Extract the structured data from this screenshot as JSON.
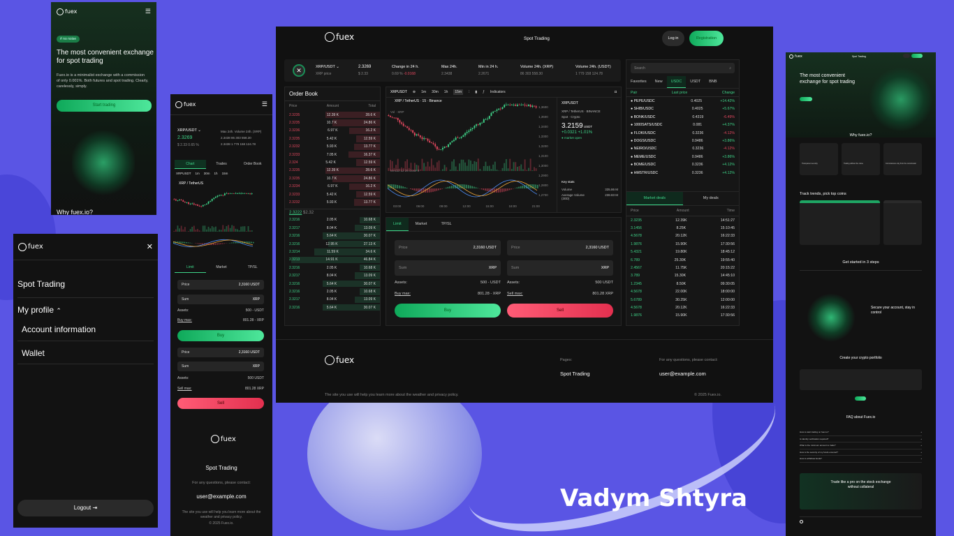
{
  "mobile_landing": {
    "logo": "fuex",
    "badge": "# no noise",
    "headline": "The most convenient exchange for spot trading",
    "description": "Fuex.io is a minimalist exchange with a commission of only 0.001%. Both futures and spot trading. Clearly, carelessly, simply.",
    "cta": "Start trading",
    "why": "Why fuex.io?"
  },
  "mobile_menu": {
    "logo": "fuex",
    "items": [
      "Spot Trading",
      "My profile"
    ],
    "sub_items": [
      "Account information",
      "Wallet"
    ],
    "logout": "Logout"
  },
  "mobile_trading": {
    "logo": "fuex",
    "pair": "XRP/USDT",
    "price": "2.3269",
    "price_sub": "$ 2.33 0.65 %",
    "stats_labels": [
      "Max 24h.",
      "Volume 24h. (XRP)"
    ],
    "stats_values": [
      "2.3438",
      "86 303 558.30"
    ],
    "stats_values2": [
      "2.3438",
      "1 779 158 124.78"
    ],
    "tabs": [
      "Chart",
      "Trades",
      "Order Book"
    ],
    "chart_symbol": "XRPUSDT",
    "timeframes": [
      "1m",
      "30m",
      "1h",
      "15m"
    ],
    "chart_title": "XRP / TetherUS",
    "order_tabs": [
      "Limit",
      "Market",
      "TP/SL"
    ],
    "price_label": "Price",
    "price_value": "2,3160 USDT",
    "sum_label": "Sum",
    "sum_unit": "XRP",
    "assets_label": "Assets:",
    "assets_value": "500 - USDT",
    "buy_max_label": "Buy max:",
    "buy_max_value": "801.28 - XRP",
    "buy": "Buy",
    "assets_value2": "500 USDT",
    "sell_max_label": "Sell max:",
    "sell_max_value": "801.28 XRP",
    "sell": "Sell",
    "footer_logo": "fuex",
    "footer_link": "Spot Trading",
    "footer_contact": "For any questions, please contact:",
    "footer_email": "user@example.com",
    "footer_note": "The site you use will help you learn more about the weather and privacy policy.",
    "footer_copy": "© 2025 Fuex.io."
  },
  "desktop": {
    "logo": "fuex",
    "nav_title": "Spot Trading",
    "login": "Log in",
    "register": "Registration",
    "ticker": {
      "pair": "XRP/USDT",
      "pair_sub": "XRP price",
      "price": "2.3269",
      "price_sub": "$ 2.33",
      "stats": [
        {
          "label": "Change in 24 h.",
          "value": "0.69 %",
          "value2": "-0.0168"
        },
        {
          "label": "Max 24h.",
          "value": "2.3438"
        },
        {
          "label": "Min in 24 h.",
          "value": "2.2671"
        },
        {
          "label": "Volume 24h. (XRP)",
          "value": "86 303 558.30"
        },
        {
          "label": "Volume 24h. (USDT)",
          "value": "1 779 158 124.78"
        }
      ]
    },
    "order_book": {
      "title": "Order Book",
      "headers": [
        "Price",
        "Amount",
        "Total"
      ],
      "asks": [
        [
          "2.3235",
          "12.39 K",
          "28.6 K"
        ],
        [
          "2.3235",
          "10.7 K",
          "24.86 K"
        ],
        [
          "2.3236",
          "6.97 K",
          "16.2 K"
        ],
        [
          "2.3235",
          "5.42 K",
          "12.59 K"
        ],
        [
          "2.3232",
          "5.93 K",
          "13.77 K"
        ],
        [
          "2.3233",
          "7.05 K",
          "16.37 K"
        ],
        [
          "2.324",
          "5.42 K",
          "12.59 K"
        ],
        [
          "2.3235",
          "12.39 K",
          "28.6 K"
        ],
        [
          "2.3235",
          "10.7 K",
          "24.86 K"
        ],
        [
          "2.3234",
          "6.97 K",
          "16.2 K"
        ],
        [
          "2.3233",
          "5.42 K",
          "12.59 K"
        ],
        [
          "2.3232",
          "5.93 K",
          "13.77 K"
        ]
      ],
      "mid": "2.3222",
      "mid_sub": "$2.32",
      "bids": [
        [
          "2.3216",
          "2.05 K",
          "10.68 K"
        ],
        [
          "2.3217",
          "8.04 K",
          "13.09 K"
        ],
        [
          "2.3216",
          "5.64 K",
          "30.07 K"
        ],
        [
          "2.3216",
          "12.95 K",
          "27.13 K"
        ],
        [
          "2.3214",
          "11.59 K",
          "34.6 K"
        ],
        [
          "2.3213",
          "14.91 K",
          "46.84 K"
        ],
        [
          "2.3216",
          "2.05 K",
          "10.68 K"
        ],
        [
          "2.3217",
          "8.04 K",
          "13.09 K"
        ],
        [
          "2.3216",
          "5.64 K",
          "30.07 K"
        ],
        [
          "2.3216",
          "2.05 K",
          "10.68 K"
        ],
        [
          "2.3217",
          "8.04 K",
          "13.09 K"
        ],
        [
          "2.3216",
          "5.64 K",
          "30.07 K"
        ]
      ]
    },
    "chart": {
      "symbol": "XRPUSDT",
      "timeframes": [
        "1m",
        "30m",
        "1h",
        "15m"
      ],
      "indicators": "Indicators",
      "title": "XRP / TetherUS · 15 · Binance",
      "vol_label": "Vol · XRP",
      "macd": "MACD 12 26 close 9",
      "price_labels": [
        "1,3600",
        "1,3500",
        "1,3400",
        "1,3300",
        "1,3200",
        "1,3100",
        "1,3000",
        "1,2900",
        "1,2800",
        "1,2700"
      ],
      "time_labels": [
        "03:00",
        "06:00",
        "09:00",
        "12:00",
        "15:00",
        "18:00",
        "21:00"
      ],
      "info_symbol": "XRPUSDT",
      "info_name": "XRP / TetherUS · BINANCE",
      "info_type": "Spot · Crypto",
      "info_price": "3.2159",
      "info_unit": "USDT",
      "info_change": "+0.0321 +1.01%",
      "info_status": "● market open",
      "key_stats": "Key stats",
      "volume_label": "Volume",
      "volume_value": "335.86 M",
      "avg_label": "Average Volume (30D)",
      "avg_value": "238.83 M"
    },
    "order_form": {
      "tabs": [
        "Limit",
        "Market",
        "TP/SL"
      ],
      "price_label": "Price",
      "price_value": "2,3160 USDT",
      "sum_label": "Sum",
      "sum_unit": "XRP",
      "assets_label": "Assets:",
      "assets_buy": "500 - USDT",
      "assets_sell": "500 USDT",
      "buy_max_label": "Buy max:",
      "buy_max_value": "801.28 - XRP",
      "sell_max_label": "Sell max:",
      "sell_max_value": "801.28 XRP",
      "buy": "Buy",
      "sell": "Sell"
    },
    "market": {
      "search_placeholder": "Search",
      "tabs": [
        "Favorites",
        "New",
        "USDC",
        "USDT",
        "BNB"
      ],
      "headers": [
        "Pair",
        "Last price",
        "Change"
      ],
      "pairs": [
        [
          "PEPE/USDC",
          "0.4025",
          "+14.42%"
        ],
        [
          "SHIB/USDC",
          "0.4025",
          "+5.67%"
        ],
        [
          "BONK/USDC",
          "0.4319",
          "-6.49%"
        ],
        [
          "1000SATS/USDC",
          "0.081",
          "+4.37%"
        ],
        [
          "FLOKI/USDC",
          "0.3236",
          "-4.12%"
        ],
        [
          "DOGS/USDC",
          "0.9486",
          "+3.86%"
        ],
        [
          "NEIRO/USDC",
          "0.3236",
          "-4.12%"
        ],
        [
          "MEME/USDC",
          "0.9486",
          "+3.86%"
        ],
        [
          "BOME/USDC",
          "0.3236",
          "+4.12%"
        ],
        [
          "HMSTR/USDC",
          "0.3236",
          "+4.12%"
        ]
      ],
      "deal_tabs": [
        "Market deals",
        "My deals"
      ],
      "deal_headers": [
        "Price",
        "Amount",
        "Time"
      ],
      "deals": [
        [
          "2.3235",
          "12.39K",
          "14:51:27"
        ],
        [
          "3.1456",
          "8.25K",
          "15:10:45"
        ],
        [
          "4.5678",
          "20.12K",
          "16:22:33"
        ],
        [
          "1.9876",
          "15.90K",
          "17:30:56"
        ],
        [
          "5.4321",
          "19.80K",
          "18:45:12"
        ],
        [
          "6.789",
          "25.30K",
          "19:55:40"
        ],
        [
          "2.4567",
          "11.75K",
          "20:15:22"
        ],
        [
          "3.789",
          "15.30K",
          "14:45:10"
        ],
        [
          "1.2345",
          "8.50K",
          "09:30:05"
        ],
        [
          "4.5678",
          "22.00K",
          "18:00:00"
        ],
        [
          "5.6789",
          "30.25K",
          "12:00:00"
        ],
        [
          "4.5678",
          "20.12K",
          "16:22:33"
        ],
        [
          "1.9876",
          "15.90K",
          "17:30:56"
        ]
      ]
    },
    "footer": {
      "logo": "fuex",
      "note": "The site you use will help you learn more about the weather and privacy policy.",
      "pages_label": "Pages:",
      "pages_link": "Spot Trading",
      "contact_label": "For any questions, please contact:",
      "email": "user@example.com",
      "copy": "© 2025 Fuex.io."
    }
  },
  "landing_page": {
    "logo": "fuex",
    "nav_title": "Spot Trading",
    "headline": "The most convenient exchange for spot trading",
    "why": "Why fuex.io?",
    "features": [
      "Transparent security",
      "Trading without the noise",
      "Commissions only from the commission"
    ],
    "trends": "Track trends, pick top coins",
    "steps_title": "Get started in 3 steps",
    "secure_title": "Secure your account, stay in control",
    "portfolio_title": "Create your crypto portfolio",
    "faq_title": "FAQ about Fuex.io",
    "faq_items": [
      "How to start trading on fuex.io?",
      "Is identity verification required?",
      "What is the minimum amount to trade?",
      "How is the security of my funds ensured?",
      "How to withdraw funds?"
    ],
    "cta": "Trade like a pro on the stock exchange without collateral"
  },
  "author": "Vadym Shtyra",
  "colors": {
    "background": "#5a55e4",
    "panel": "#141414",
    "green": "#3fd68a",
    "red": "#e5485f"
  }
}
